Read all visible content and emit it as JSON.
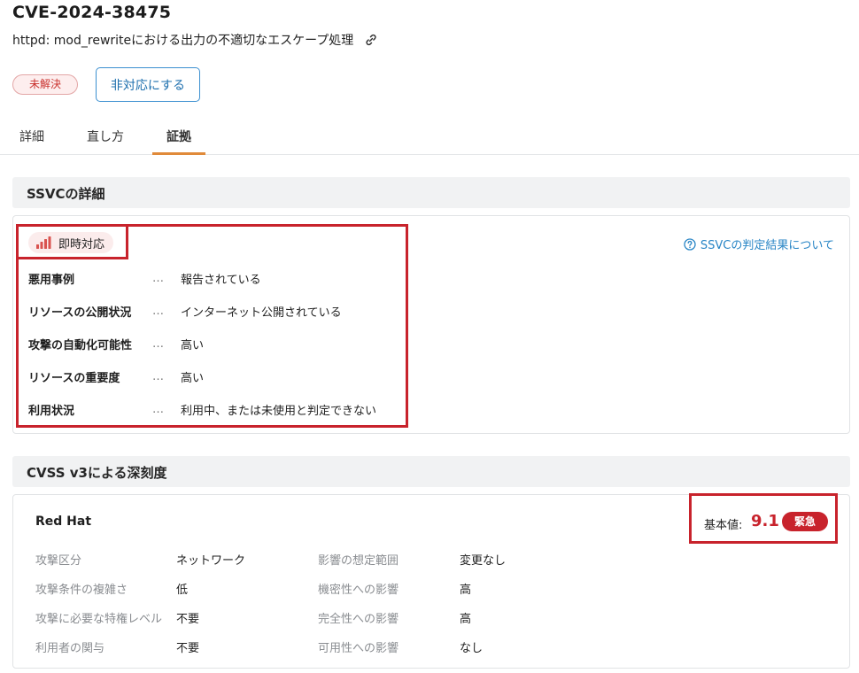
{
  "header": {
    "cve_id": "CVE-2024-38475",
    "subtitle": "httpd: mod_rewriteにおける出力の不適切なエスケープ処理",
    "status": "未解決",
    "ignore_button_label": "非対応にする"
  },
  "tabs": [
    {
      "label": "詳細"
    },
    {
      "label": "直し方"
    },
    {
      "label": "証拠",
      "active": true
    }
  ],
  "ssvc": {
    "section_title": "SSVCの詳細",
    "decision": "即時対応",
    "about_link": "SSVCの判定結果について",
    "separator": "…",
    "rows": [
      {
        "label": "悪用事例",
        "value": "報告されている"
      },
      {
        "label": "リソースの公開状況",
        "value": "インターネット公開されている"
      },
      {
        "label": "攻撃の自動化可能性",
        "value": "高い"
      },
      {
        "label": "リソースの重要度",
        "value": "高い"
      },
      {
        "label": "利用状況",
        "value": "利用中、または未使用と判定できない"
      }
    ]
  },
  "cvss": {
    "section_title": "CVSS v3による深刻度",
    "vendor": "Red Hat",
    "base_score_label": "基本値:",
    "base_score": "9.1",
    "severity": "緊急",
    "metrics_left": [
      {
        "label": "攻撃区分",
        "value": "ネットワーク"
      },
      {
        "label": "攻撃条件の複雑さ",
        "value": "低"
      },
      {
        "label": "攻撃に必要な特権レベル",
        "value": "不要"
      },
      {
        "label": "利用者の関与",
        "value": "不要"
      }
    ],
    "metrics_right": [
      {
        "label": "影響の想定範囲",
        "value": "変更なし"
      },
      {
        "label": "機密性への影響",
        "value": "高"
      },
      {
        "label": "完全性への影響",
        "value": "高"
      },
      {
        "label": "可用性への影響",
        "value": "なし"
      }
    ]
  },
  "colors": {
    "accent_red": "#c8232c",
    "link_blue": "#2a86c6",
    "tab_underline": "#e08a3a"
  },
  "icons": {
    "copy_link": "link-icon",
    "decision": "signal-bars-icon",
    "help": "question-circle-icon"
  }
}
